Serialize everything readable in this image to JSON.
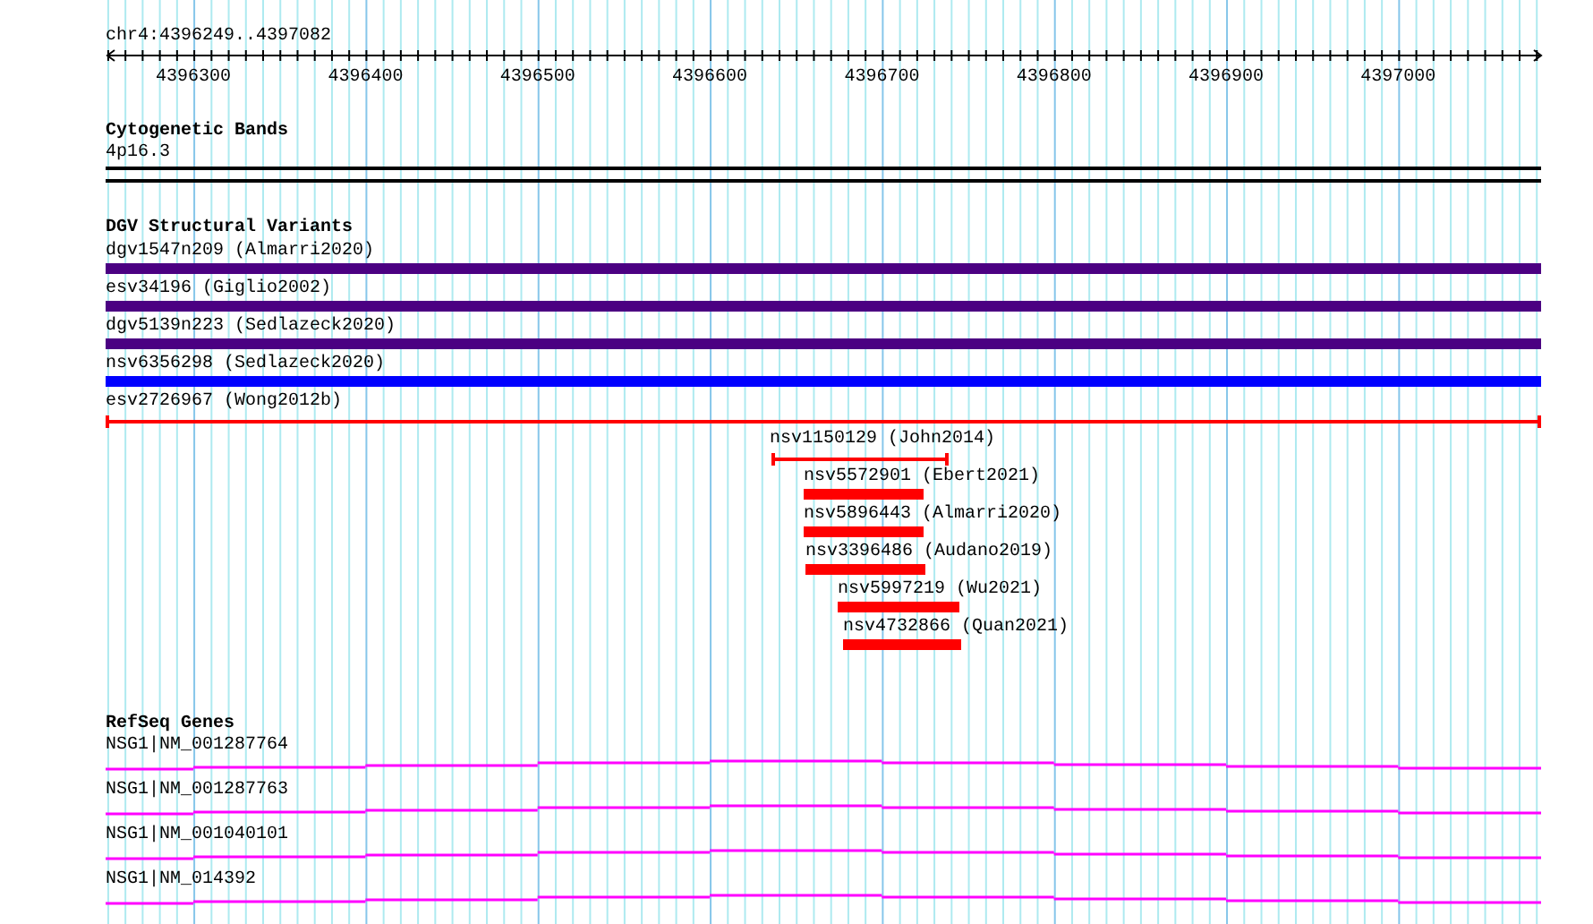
{
  "ruler": {
    "location": "chr4:4396249..4397082",
    "tick_labels": [
      "4396300",
      "4396400",
      "4396500",
      "4396600",
      "4396700",
      "4396800",
      "4396900",
      "4397000"
    ]
  },
  "cytogenetic_bands": {
    "title": "Cytogenetic Bands",
    "band": "4p16.3"
  },
  "dgv_structural_variants": {
    "title": "DGV Structural Variants",
    "items": [
      {
        "label": "dgv1547n209 (Almarri2020)",
        "kind": "bar",
        "color": "#4b0082"
      },
      {
        "label": "esv34196 (Giglio2002)",
        "kind": "bar",
        "color": "#4b0082"
      },
      {
        "label": "dgv5139n223 (Sedlazeck2020)",
        "kind": "bar",
        "color": "#4b0082"
      },
      {
        "label": "nsv6356298 (Sedlazeck2020)",
        "kind": "bar",
        "color": "#0000ff"
      },
      {
        "label": "esv2726967 (Wong2012b)",
        "kind": "span",
        "color": "#ff0000"
      },
      {
        "label": "nsv1150129 (John2014)",
        "kind": "span",
        "color": "#ff0000"
      },
      {
        "label": "nsv5572901 (Ebert2021)",
        "kind": "bar",
        "color": "#ff0000"
      },
      {
        "label": "nsv5896443 (Almarri2020)",
        "kind": "bar",
        "color": "#ff0000"
      },
      {
        "label": "nsv3396486 (Audano2019)",
        "kind": "bar",
        "color": "#ff0000"
      },
      {
        "label": "nsv5997219 (Wu2021)",
        "kind": "bar",
        "color": "#ff0000"
      },
      {
        "label": "nsv4732866 (Quan2021)",
        "kind": "bar",
        "color": "#ff0000"
      }
    ]
  },
  "refseq_genes": {
    "title": "RefSeq Genes",
    "genes": [
      "NSG1|NM_001287764",
      "NSG1|NM_001287763",
      "NSG1|NM_001040101",
      "NSG1|NM_014392"
    ]
  }
}
